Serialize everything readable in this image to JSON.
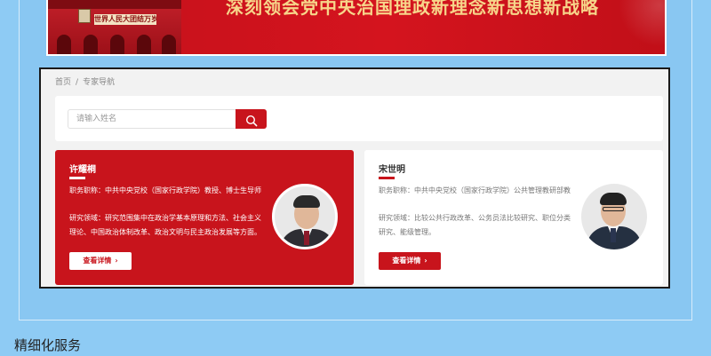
{
  "banner": {
    "slogan": "深刻领会党中央治国理政新理念新思想新战略",
    "plaque_text": "世界人民大团结万岁"
  },
  "breadcrumb": {
    "home": "首页",
    "separator": "/",
    "current": "专家导航"
  },
  "search": {
    "placeholder": "请输入姓名",
    "value": ""
  },
  "experts": [
    {
      "name": "许耀桐",
      "title_line": "职务职称：中共中央党校（国家行政学院）教授、博士生导师",
      "field_line": "研究领域：研究范围集中在政治学基本原理和方法、社会主义理论、中国政治体制改革、政治文明与民主政治发展等方面。",
      "button": "查看详情",
      "chevron": "›"
    },
    {
      "name": "宋世明",
      "title_line": "职务职称：中共中央党校（国家行政学院）公共管理教研部教",
      "field_line": "研究领域：比较公共行政改革、公务员法比较研究、职位分类研究、能级管理。",
      "button": "查看详情",
      "chevron": "›"
    }
  ],
  "section_title": "精细化服务",
  "colors": {
    "accent": "#c8141c",
    "page_bg": "#8ecbf4",
    "frame_bg": "#f2f2f2"
  },
  "icons": {
    "search": "search-icon",
    "chevron": "chevron-right-icon"
  }
}
